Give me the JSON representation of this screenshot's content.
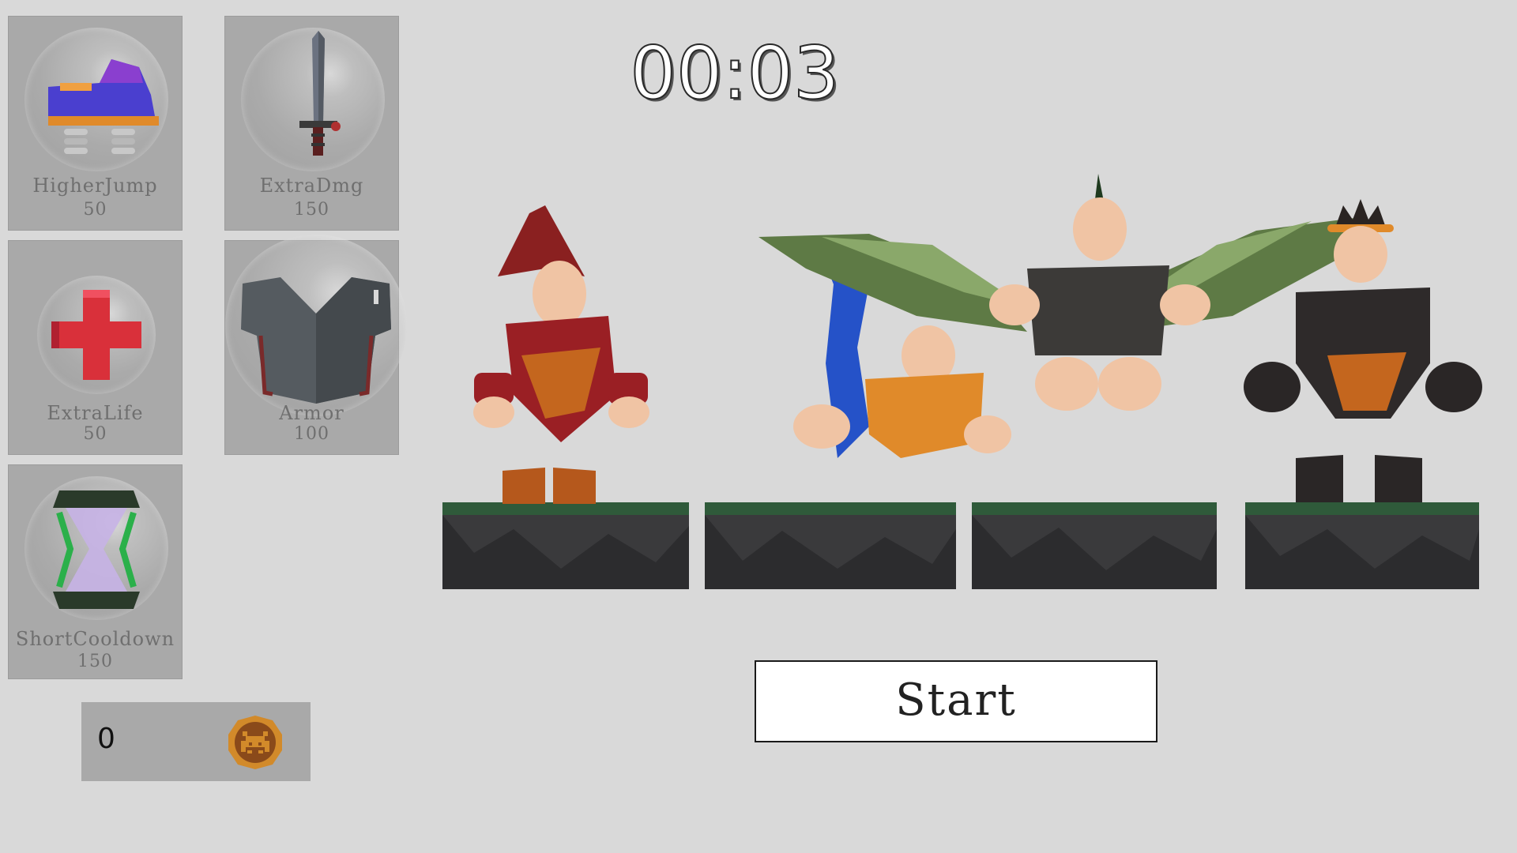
{
  "timer": {
    "value": "00:03"
  },
  "shop": {
    "items": [
      {
        "name": "HigherJump",
        "price": "50",
        "icon": "spring-boot-icon"
      },
      {
        "name": "ExtraDmg",
        "price": "150",
        "icon": "sword-icon"
      },
      {
        "name": "ExtraLife",
        "price": "50",
        "icon": "red-cross-icon"
      },
      {
        "name": "Armor",
        "price": "100",
        "icon": "armor-icon"
      },
      {
        "name": "ShortCooldown",
        "price": "150",
        "icon": "hourglass-icon"
      }
    ]
  },
  "wallet": {
    "coins": "0",
    "icon": "coin-icon"
  },
  "start_button": {
    "label": "Start"
  },
  "characters": [
    {
      "icon": "wizard-character-icon"
    },
    {
      "icon": "mermaid-character-icon"
    },
    {
      "icon": "winged-character-icon"
    },
    {
      "icon": "crowned-character-icon"
    }
  ],
  "colors": {
    "background": "#d9d9d9",
    "card": "#a9a9a9",
    "card_text": "#6f6f6f",
    "coin": "#d28a2a"
  }
}
